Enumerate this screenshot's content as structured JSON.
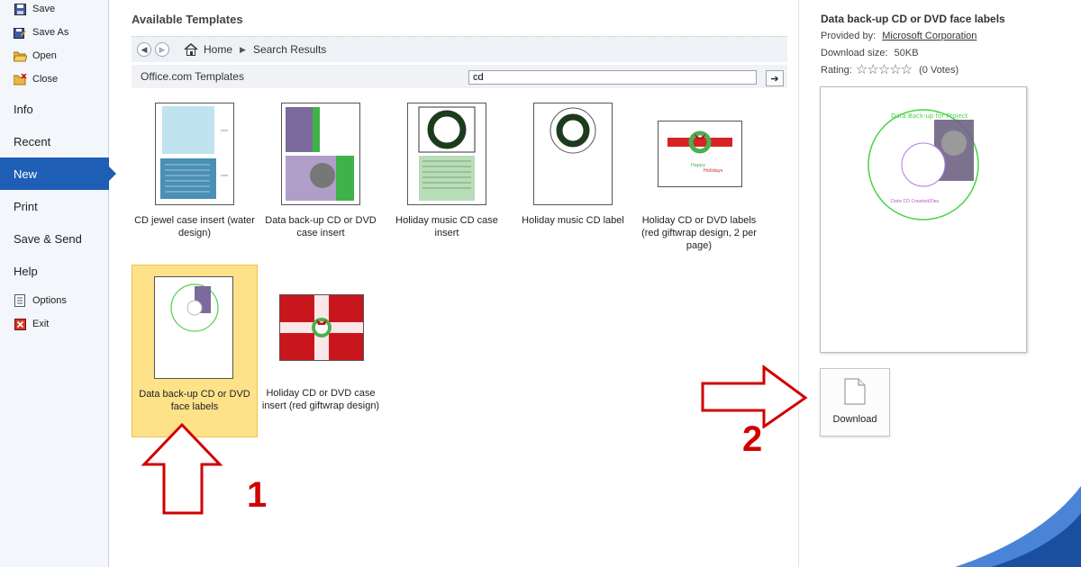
{
  "nav": {
    "small_top": [
      {
        "label": "Save",
        "icon": "save-icon"
      },
      {
        "label": "Save As",
        "icon": "save-as-icon"
      },
      {
        "label": "Open",
        "icon": "open-folder-icon"
      },
      {
        "label": "Close",
        "icon": "close-folder-icon"
      }
    ],
    "big": [
      {
        "label": "Info"
      },
      {
        "label": "Recent"
      },
      {
        "label": "New",
        "selected": true
      },
      {
        "label": "Print"
      },
      {
        "label": "Save & Send"
      },
      {
        "label": "Help"
      }
    ],
    "small_bottom": [
      {
        "label": "Options",
        "icon": "options-icon"
      },
      {
        "label": "Exit",
        "icon": "exit-icon"
      }
    ],
    "accent": "#1e5fb5"
  },
  "main": {
    "title": "Available Templates",
    "breadcrumb": {
      "home": "Home",
      "current": "Search Results"
    },
    "office_label": "Office.com Templates",
    "search_value": "cd",
    "templates": [
      {
        "caption": "CD jewel case insert (water design)"
      },
      {
        "caption": "Data back-up CD or DVD case insert"
      },
      {
        "caption": "Holiday music CD case insert"
      },
      {
        "caption": "Holiday music CD label"
      },
      {
        "caption": "Holiday CD or DVD labels (red giftwrap design, 2 per page)"
      },
      {
        "caption": "Data back-up CD or DVD face labels",
        "selected": true
      },
      {
        "caption": "Holiday CD or DVD case insert (red giftwrap design)"
      }
    ]
  },
  "details": {
    "title": "Data back-up CD or DVD face labels",
    "provided_label": "Provided by:",
    "provider": "Microsoft Corporation",
    "size_label": "Download size:",
    "size_value": "50KB",
    "rating_label": "Rating:",
    "rating": 0,
    "votes": "(0 Votes)",
    "preview_text_top": "Data Back-up for Project",
    "preview_text_bottom": "Date CD Created/Des",
    "download_label": "Download"
  },
  "annotations": {
    "one": "1",
    "two": "2",
    "color": "#d10000"
  }
}
